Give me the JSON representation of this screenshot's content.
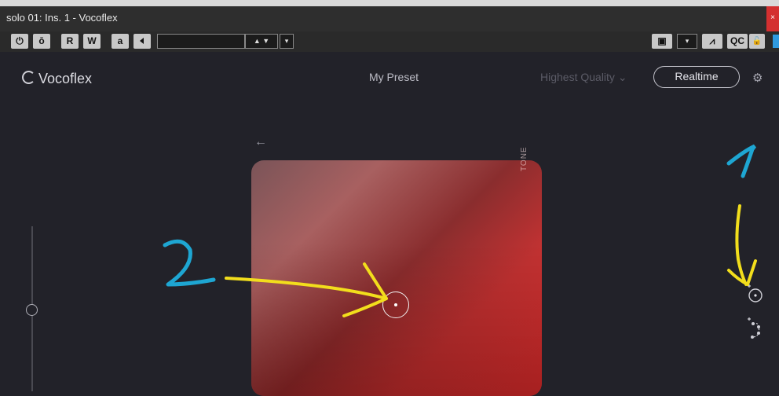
{
  "window": {
    "title": "solo 01: Ins. 1 - Vocoflex",
    "close_label": "×"
  },
  "toolbar": {
    "power_label": "⏻",
    "compare_label": "ō",
    "read_label": "R",
    "write_label": "W",
    "auto_label": "a",
    "preset_arrows": "▲ ▼",
    "preset_dropdown": "▾",
    "camera_label": "▣",
    "routing_dropdown": "▾",
    "activity_label": "⩘",
    "qc_label": "QC",
    "lock_label": "🔓"
  },
  "header": {
    "logo": "Vocoflex",
    "preset_name": "My Preset",
    "quality": "Highest Quality",
    "quality_chevron": "⌄",
    "mode_button": "Realtime",
    "settings_icon": "⚙"
  },
  "pad": {
    "back_arrow": "←",
    "axis_label": "TONE"
  },
  "annotations": {
    "one": "1",
    "two": "2"
  },
  "colors": {
    "accent_blue": "#2f9ae0",
    "annotation_yellow": "#f2de1c",
    "annotation_cyan": "#1ea6d2"
  }
}
